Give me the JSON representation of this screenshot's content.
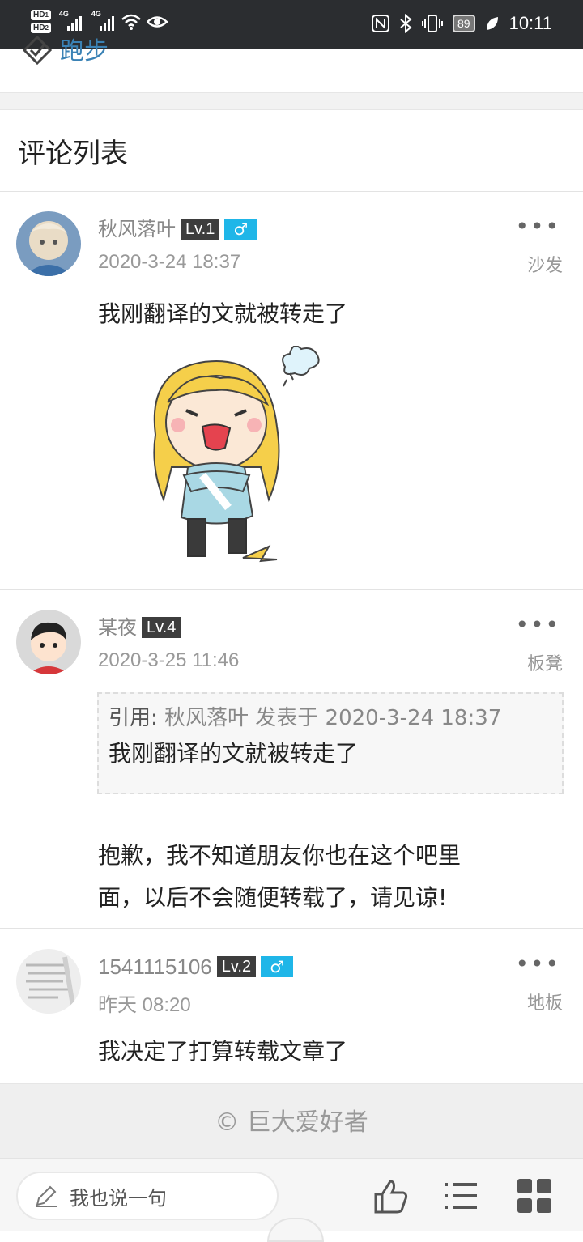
{
  "status_bar": {
    "hd1": "HD",
    "hd1_sub": "1",
    "hd2": "HD",
    "hd2_sub": "2",
    "net1": "4G",
    "net2": "4G",
    "battery": "89",
    "time": "10:11"
  },
  "prev_section": {
    "run_link": "跑步"
  },
  "comments": {
    "title": "评论列表",
    "posts": [
      {
        "username": "秋风落叶",
        "level": "Lv.1",
        "gender": "♂",
        "date": "2020-3-24 18:37",
        "floor": "沙发",
        "more": "•••",
        "text": "我刚翻译的文就被转走了"
      },
      {
        "username": "某夜",
        "level": "Lv.4",
        "date": "2020-3-25 11:46",
        "floor": "板凳",
        "more": "•••",
        "quote_label": "引用:",
        "quote_meta": "秋风落叶 发表于 2020-3-24 18:37",
        "quote_text": "我刚翻译的文就被转走了",
        "text_line1": "抱歉，我不知道朋友你也在这个吧里",
        "text_line2": "面，以后不会随便转载了，请见谅!"
      },
      {
        "username": "1541115106",
        "level": "Lv.2",
        "gender": "♂",
        "date": "昨天 08:20",
        "floor": "地板",
        "more": "•••",
        "text": "我决定了打算转载文章了"
      }
    ]
  },
  "footer": {
    "copyright": "© 巨大爱好者"
  },
  "bottom_bar": {
    "reply_placeholder": "我也说一句",
    "icons": [
      "like-icon",
      "list-icon",
      "grid-icon"
    ]
  },
  "colors": {
    "link": "#3a82b5",
    "level_badge": "#3d3d3d",
    "gender_badge": "#1fb6e8",
    "status_bar": "#2b2d30"
  }
}
